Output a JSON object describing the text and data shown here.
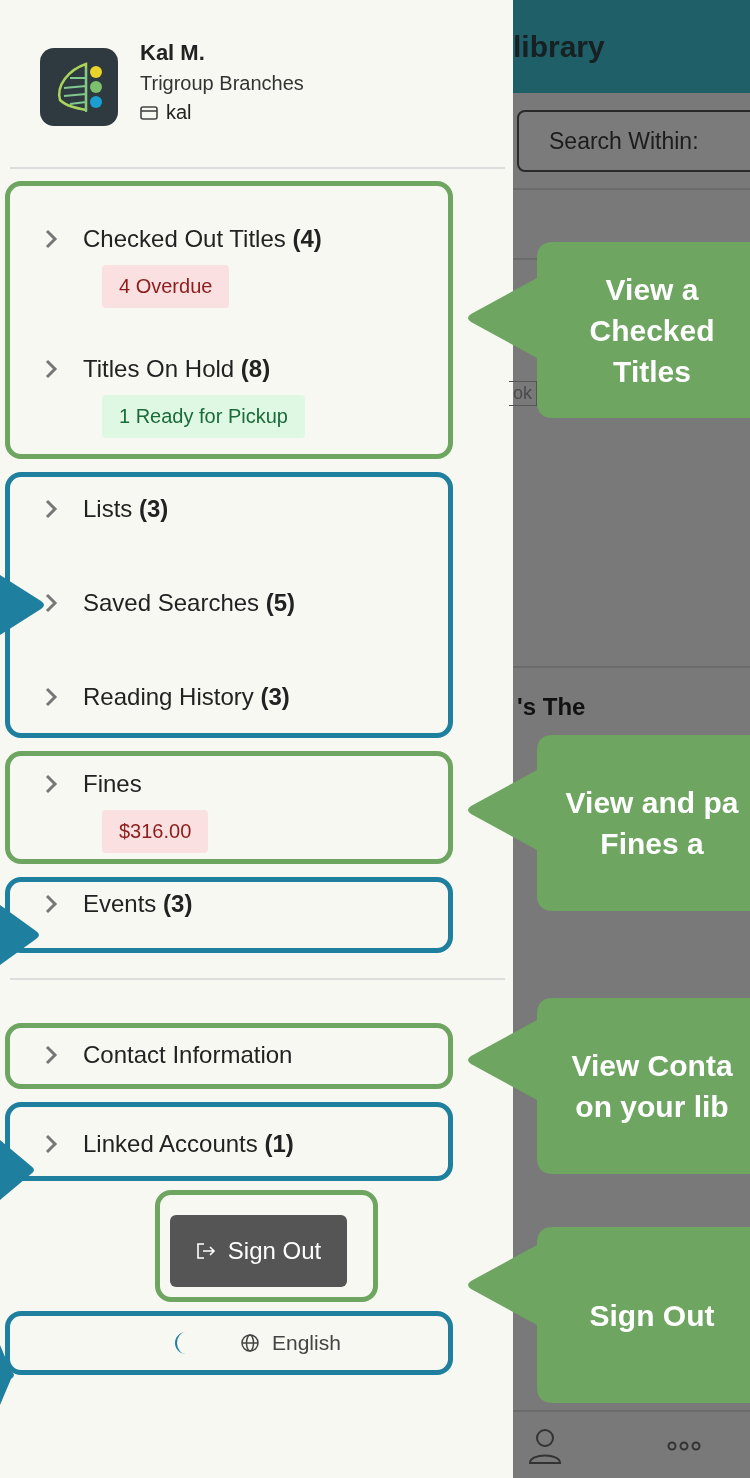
{
  "profile": {
    "name": "Kal M.",
    "library": "Trigroup Branches",
    "card": "kal"
  },
  "menu_groups": [
    {
      "color": "#6ea561",
      "items": [
        {
          "label": "Checked Out Titles **(4)**",
          "badge": {
            "text": "4 Overdue",
            "kind": "danger"
          }
        },
        {
          "label": "Titles On Hold **(8)**",
          "badge": {
            "text": "1 Ready for Pickup",
            "kind": "success"
          }
        }
      ]
    },
    {
      "color": "#1e7f9f",
      "items": [
        {
          "label": "Lists **(3)**"
        },
        {
          "label": "Saved Searches **(5)**"
        },
        {
          "label": "Reading History **(3)**"
        }
      ]
    },
    {
      "color": "#6ea561",
      "items": [
        {
          "label": "Fines",
          "badge": {
            "text": "$316.00",
            "kind": "danger"
          }
        }
      ]
    },
    {
      "color": "#1e7f9f",
      "items": [
        {
          "label": "Events **(3)**"
        }
      ]
    },
    {
      "color": "#6ea561",
      "divider_before": true,
      "items": [
        {
          "label": "Contact Information"
        }
      ]
    },
    {
      "color": "#1e7f9f",
      "items": [
        {
          "label": "Linked Accounts **(1)**"
        }
      ]
    }
  ],
  "sign_out": {
    "label": "Sign Out",
    "color": "#6ea561"
  },
  "footer": {
    "language": "English",
    "color": "#1e7f9f"
  },
  "background_app": {
    "header_title": "library",
    "search_button": "Search Within:",
    "chip": "ok",
    "heading": "'s The"
  },
  "callouts": [
    {
      "lines": [
        "View a",
        "Checked",
        "Titles"
      ]
    },
    {
      "lines": [
        "View and pa",
        "Fines a"
      ]
    },
    {
      "lines": [
        "View Conta",
        "on your lib"
      ]
    },
    {
      "lines": [
        "Sign Out"
      ]
    }
  ]
}
